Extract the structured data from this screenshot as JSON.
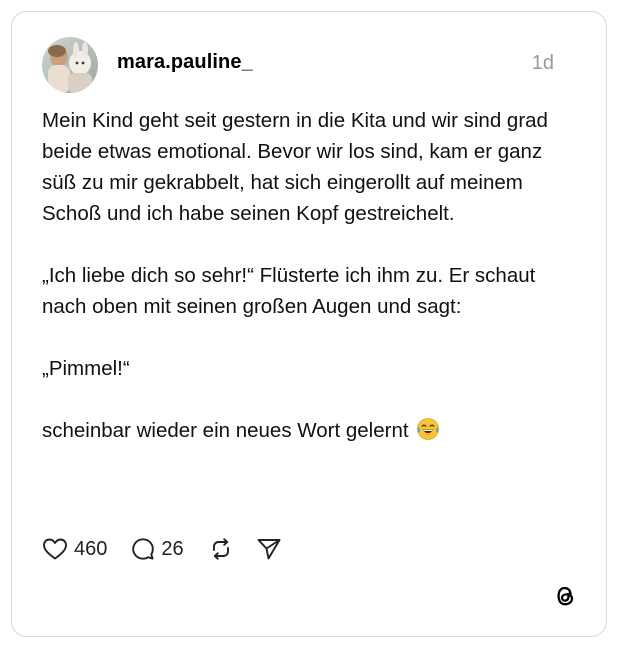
{
  "post": {
    "username": "mara.pauline_",
    "timestamp": "1d",
    "paragraphs": [
      "Mein Kind geht seit gestern in die Kita und wir sind grad beide etwas emotional. Bevor wir los sind, kam er ganz süß zu mir gekrabbelt, hat sich eingerollt auf meinem Schoß und ich habe seinen Kopf gestreichelt.",
      "„Ich liebe dich so sehr!“ Flüsterte ich ihm zu. Er schaut nach oben mit seinen großen Augen und sagt:",
      "„Pimmel!“",
      "scheinbar wieder ein neues Wort gelernt"
    ],
    "last_line_emoji": "tears-of-joy-emoji"
  },
  "actions": {
    "like_count": "460",
    "reply_count": "26",
    "icons": [
      "heart-icon",
      "comment-icon",
      "repost-icon",
      "share-icon"
    ]
  },
  "brand": {
    "logo": "threads-logo",
    "text_color": "#000000",
    "muted_color": "#9a9a9a",
    "border_color": "#d9d9d9"
  }
}
